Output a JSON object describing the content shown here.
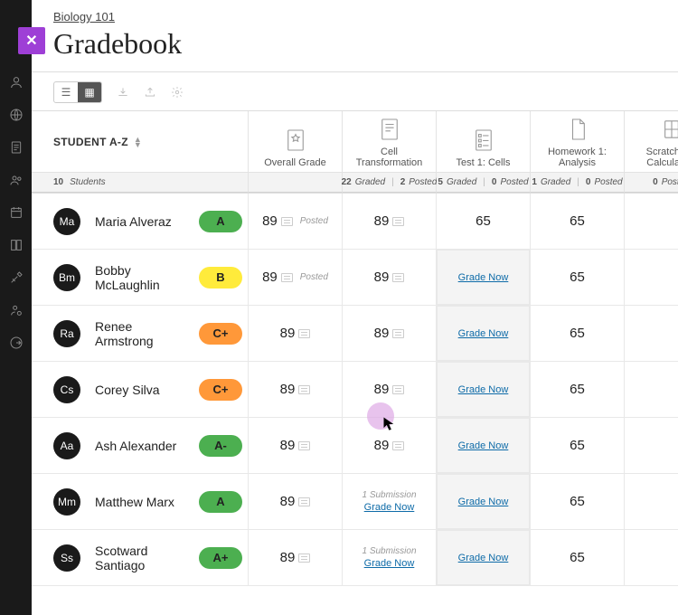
{
  "header": {
    "breadcrumb": "Biology 101",
    "title": "Gradebook"
  },
  "sort": {
    "label": "STUDENT A-Z"
  },
  "columns": [
    {
      "name": "Overall Grade"
    },
    {
      "name": "Cell Transformation"
    },
    {
      "name": "Test 1: Cells"
    },
    {
      "name": "Homework 1: Analysis"
    },
    {
      "name": "Scratchpad Calculation"
    }
  ],
  "subheaders": {
    "student_count": "10",
    "student_label": "Students",
    "stats": [
      {
        "graded": "22",
        "posted": "2"
      },
      {
        "graded": "5",
        "posted": "0"
      },
      {
        "graded": "1",
        "posted": "0"
      },
      {
        "graded": "0",
        "posted_only": true
      }
    ],
    "graded_label": "Graded",
    "posted_label": "Posted"
  },
  "labels": {
    "grade_now": "Grade Now",
    "posted": "Posted",
    "submission": "1 Submission"
  },
  "students": [
    {
      "init": "Ma",
      "name": "Maria Alveraz",
      "pill": "A",
      "pill_class": "A",
      "c1": "89",
      "c1_posted": true,
      "c2": "89",
      "c3_val": "65",
      "c4": "65"
    },
    {
      "init": "Bm",
      "name": "Bobby McLaughlin",
      "pill": "B",
      "pill_class": "B",
      "c1": "89",
      "c1_posted": true,
      "c2": "89",
      "c3_grade_now": true,
      "c4": "65"
    },
    {
      "init": "Ra",
      "name": "Renee Armstrong",
      "pill": "C+",
      "pill_class": "C",
      "c1": "89",
      "c2": "89",
      "c3_grade_now": true,
      "c4": "65"
    },
    {
      "init": "Cs",
      "name": "Corey Silva",
      "pill": "C+",
      "pill_class": "C",
      "c1": "89",
      "c2": "89",
      "c3_grade_now": true,
      "c4": "65"
    },
    {
      "init": "Aa",
      "name": "Ash Alexander",
      "pill": "A-",
      "pill_class": "Am",
      "c1": "89",
      "c2": "89",
      "c3_grade_now": true,
      "c4": "65"
    },
    {
      "init": "Mm",
      "name": "Matthew Marx",
      "pill": "A",
      "pill_class": "A",
      "c1": "89",
      "c2_submission": true,
      "c3_grade_now": true,
      "c4": "65"
    },
    {
      "init": "Ss",
      "name": "Scotward Santiago",
      "pill": "A+",
      "pill_class": "Ap",
      "c1": "89",
      "c2_submission": true,
      "c3_grade_now": true,
      "c4": "65"
    }
  ]
}
